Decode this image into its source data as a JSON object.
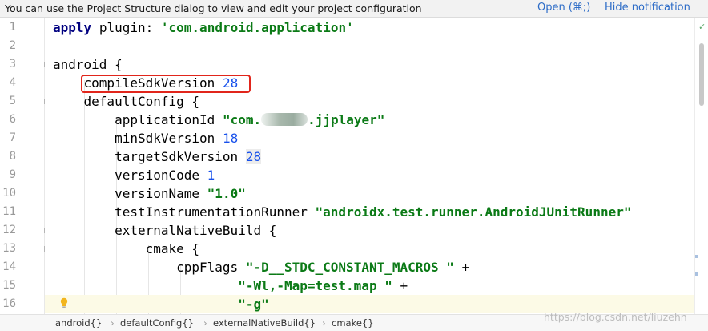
{
  "notification": {
    "message": "You can use the Project Structure dialog to view and edit your project configuration",
    "open_label": "Open (⌘;)",
    "hide_label": "Hide notification"
  },
  "editor": {
    "current_line": 16,
    "lines": [
      {
        "n": "1"
      },
      {
        "n": "2"
      },
      {
        "n": "3"
      },
      {
        "n": "4"
      },
      {
        "n": "5"
      },
      {
        "n": "6"
      },
      {
        "n": "7"
      },
      {
        "n": "8"
      },
      {
        "n": "9"
      },
      {
        "n": "10"
      },
      {
        "n": "11"
      },
      {
        "n": "12"
      },
      {
        "n": "13"
      },
      {
        "n": "14"
      },
      {
        "n": "15"
      },
      {
        "n": "16"
      }
    ],
    "tokens": {
      "l1_apply": "apply",
      "l1_plugin": "plugin:",
      "l1_str": "'com.android.application'",
      "l3_android": "android {",
      "l4_key": "compileSdkVersion",
      "l4_val": "28",
      "l5_key": "defaultConfig {",
      "l6_key": "applicationId",
      "l6_str_a": "\"com.",
      "l6_str_b": ".jjplayer\"",
      "l7_key": "minSdkVersion",
      "l7_val": "18",
      "l8_key": "targetSdkVersion",
      "l8_val": "28",
      "l9_key": "versionCode",
      "l9_val": "1",
      "l10_key": "versionName",
      "l10_str": "\"1.0\"",
      "l11_key": "testInstrumentationRunner",
      "l11_str": "\"androidx.test.runner.AndroidJUnitRunner\"",
      "l12_key": "externalNativeBuild {",
      "l13_key": "cmake {",
      "l14_key": "cppFlags",
      "l14_str": "\"-D__STDC_CONSTANT_MACROS \"",
      "l14_plus": "+",
      "l15_str": "\"-Wl,-Map=test.map \"",
      "l15_plus": "+",
      "l16_str": "\"-g\""
    }
  },
  "breadcrumb": [
    "android{}",
    "defaultConfig{}",
    "externalNativeBuild{}",
    "cmake{}"
  ],
  "watermark": "https://blog.csdn.net/liuzehn",
  "colors": {
    "keyword": "#000080",
    "string": "#0b7a16",
    "number": "#1750eb",
    "highlight_box": "#e1251b",
    "link": "#2d6cc7"
  },
  "icons": {
    "intention": "lightbulb-icon",
    "inspection": "checkmark-icon"
  }
}
